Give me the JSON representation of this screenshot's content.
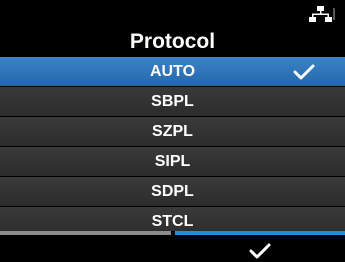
{
  "header": {
    "title": "Protocol",
    "status_icon": "network-icon"
  },
  "list": {
    "items": [
      {
        "label": "AUTO",
        "selected": true
      },
      {
        "label": "SBPL",
        "selected": false
      },
      {
        "label": "SZPL",
        "selected": false
      },
      {
        "label": "SIPL",
        "selected": false
      },
      {
        "label": "SDPL",
        "selected": false
      },
      {
        "label": "STCL",
        "selected": false
      }
    ],
    "selected_icon": "checkmark-icon"
  },
  "footer": {
    "left_key": "",
    "right_key_icon": "checkmark-icon"
  },
  "colors": {
    "selected_row": "#2f75bb",
    "row": "#333333",
    "accent": "#1f8fd8"
  }
}
